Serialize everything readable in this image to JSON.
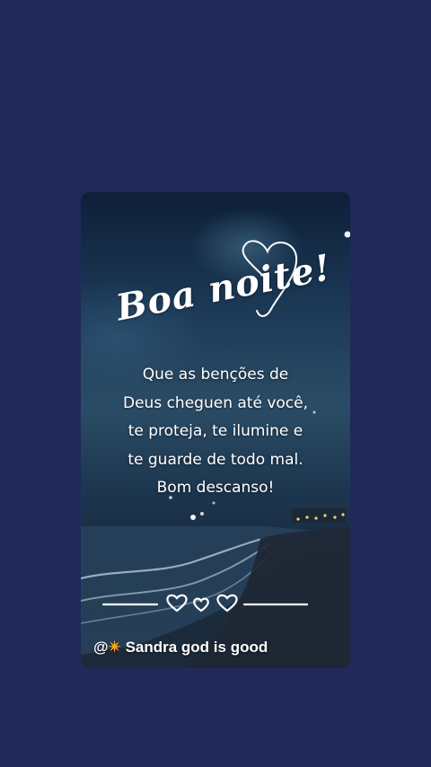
{
  "card": {
    "title": "Boa noite!",
    "message_lines": [
      "Que as benções de",
      "Deus cheguen até você,",
      "te proteja, te ilumine e",
      "te guarde de todo mal.",
      "Bom descanso!"
    ],
    "watermark": {
      "prefix": "@",
      "icon": "sun-icon",
      "icon_glyph": "✴",
      "author": "Sandra god is good"
    }
  },
  "colors": {
    "page_background": "#20295a",
    "text": "#ffffff"
  }
}
